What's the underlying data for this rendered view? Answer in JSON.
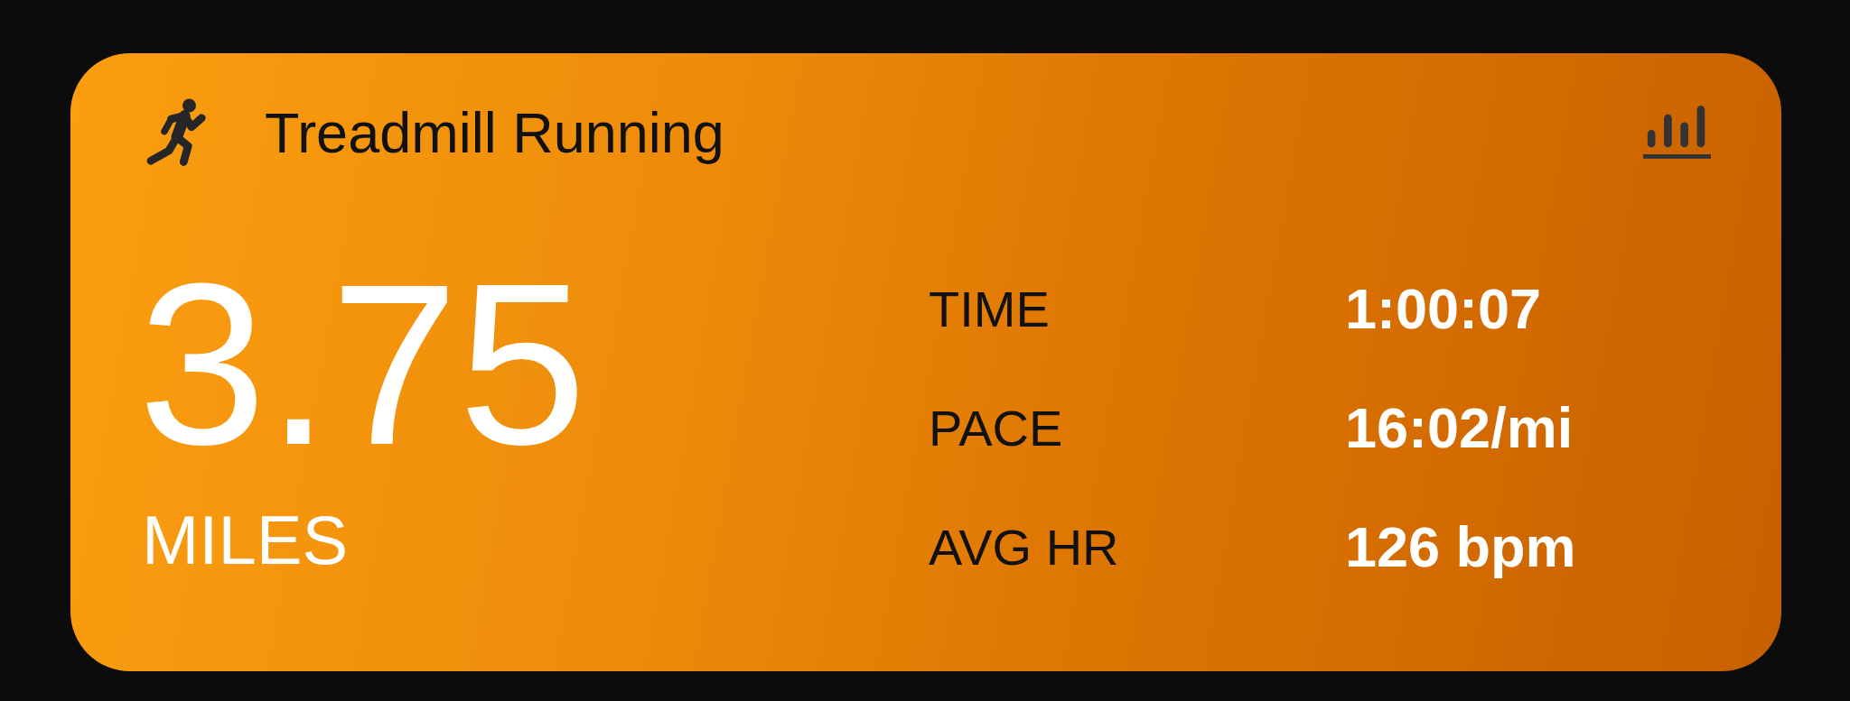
{
  "workout": {
    "title": "Treadmill Running",
    "distance": "3.75",
    "distance_unit": "MILES",
    "stats": [
      {
        "label": "TIME",
        "value": "1:00:07"
      },
      {
        "label": "PACE",
        "value": "16:02/mi"
      },
      {
        "label": "AVG HR",
        "value": "126 bpm"
      }
    ]
  }
}
